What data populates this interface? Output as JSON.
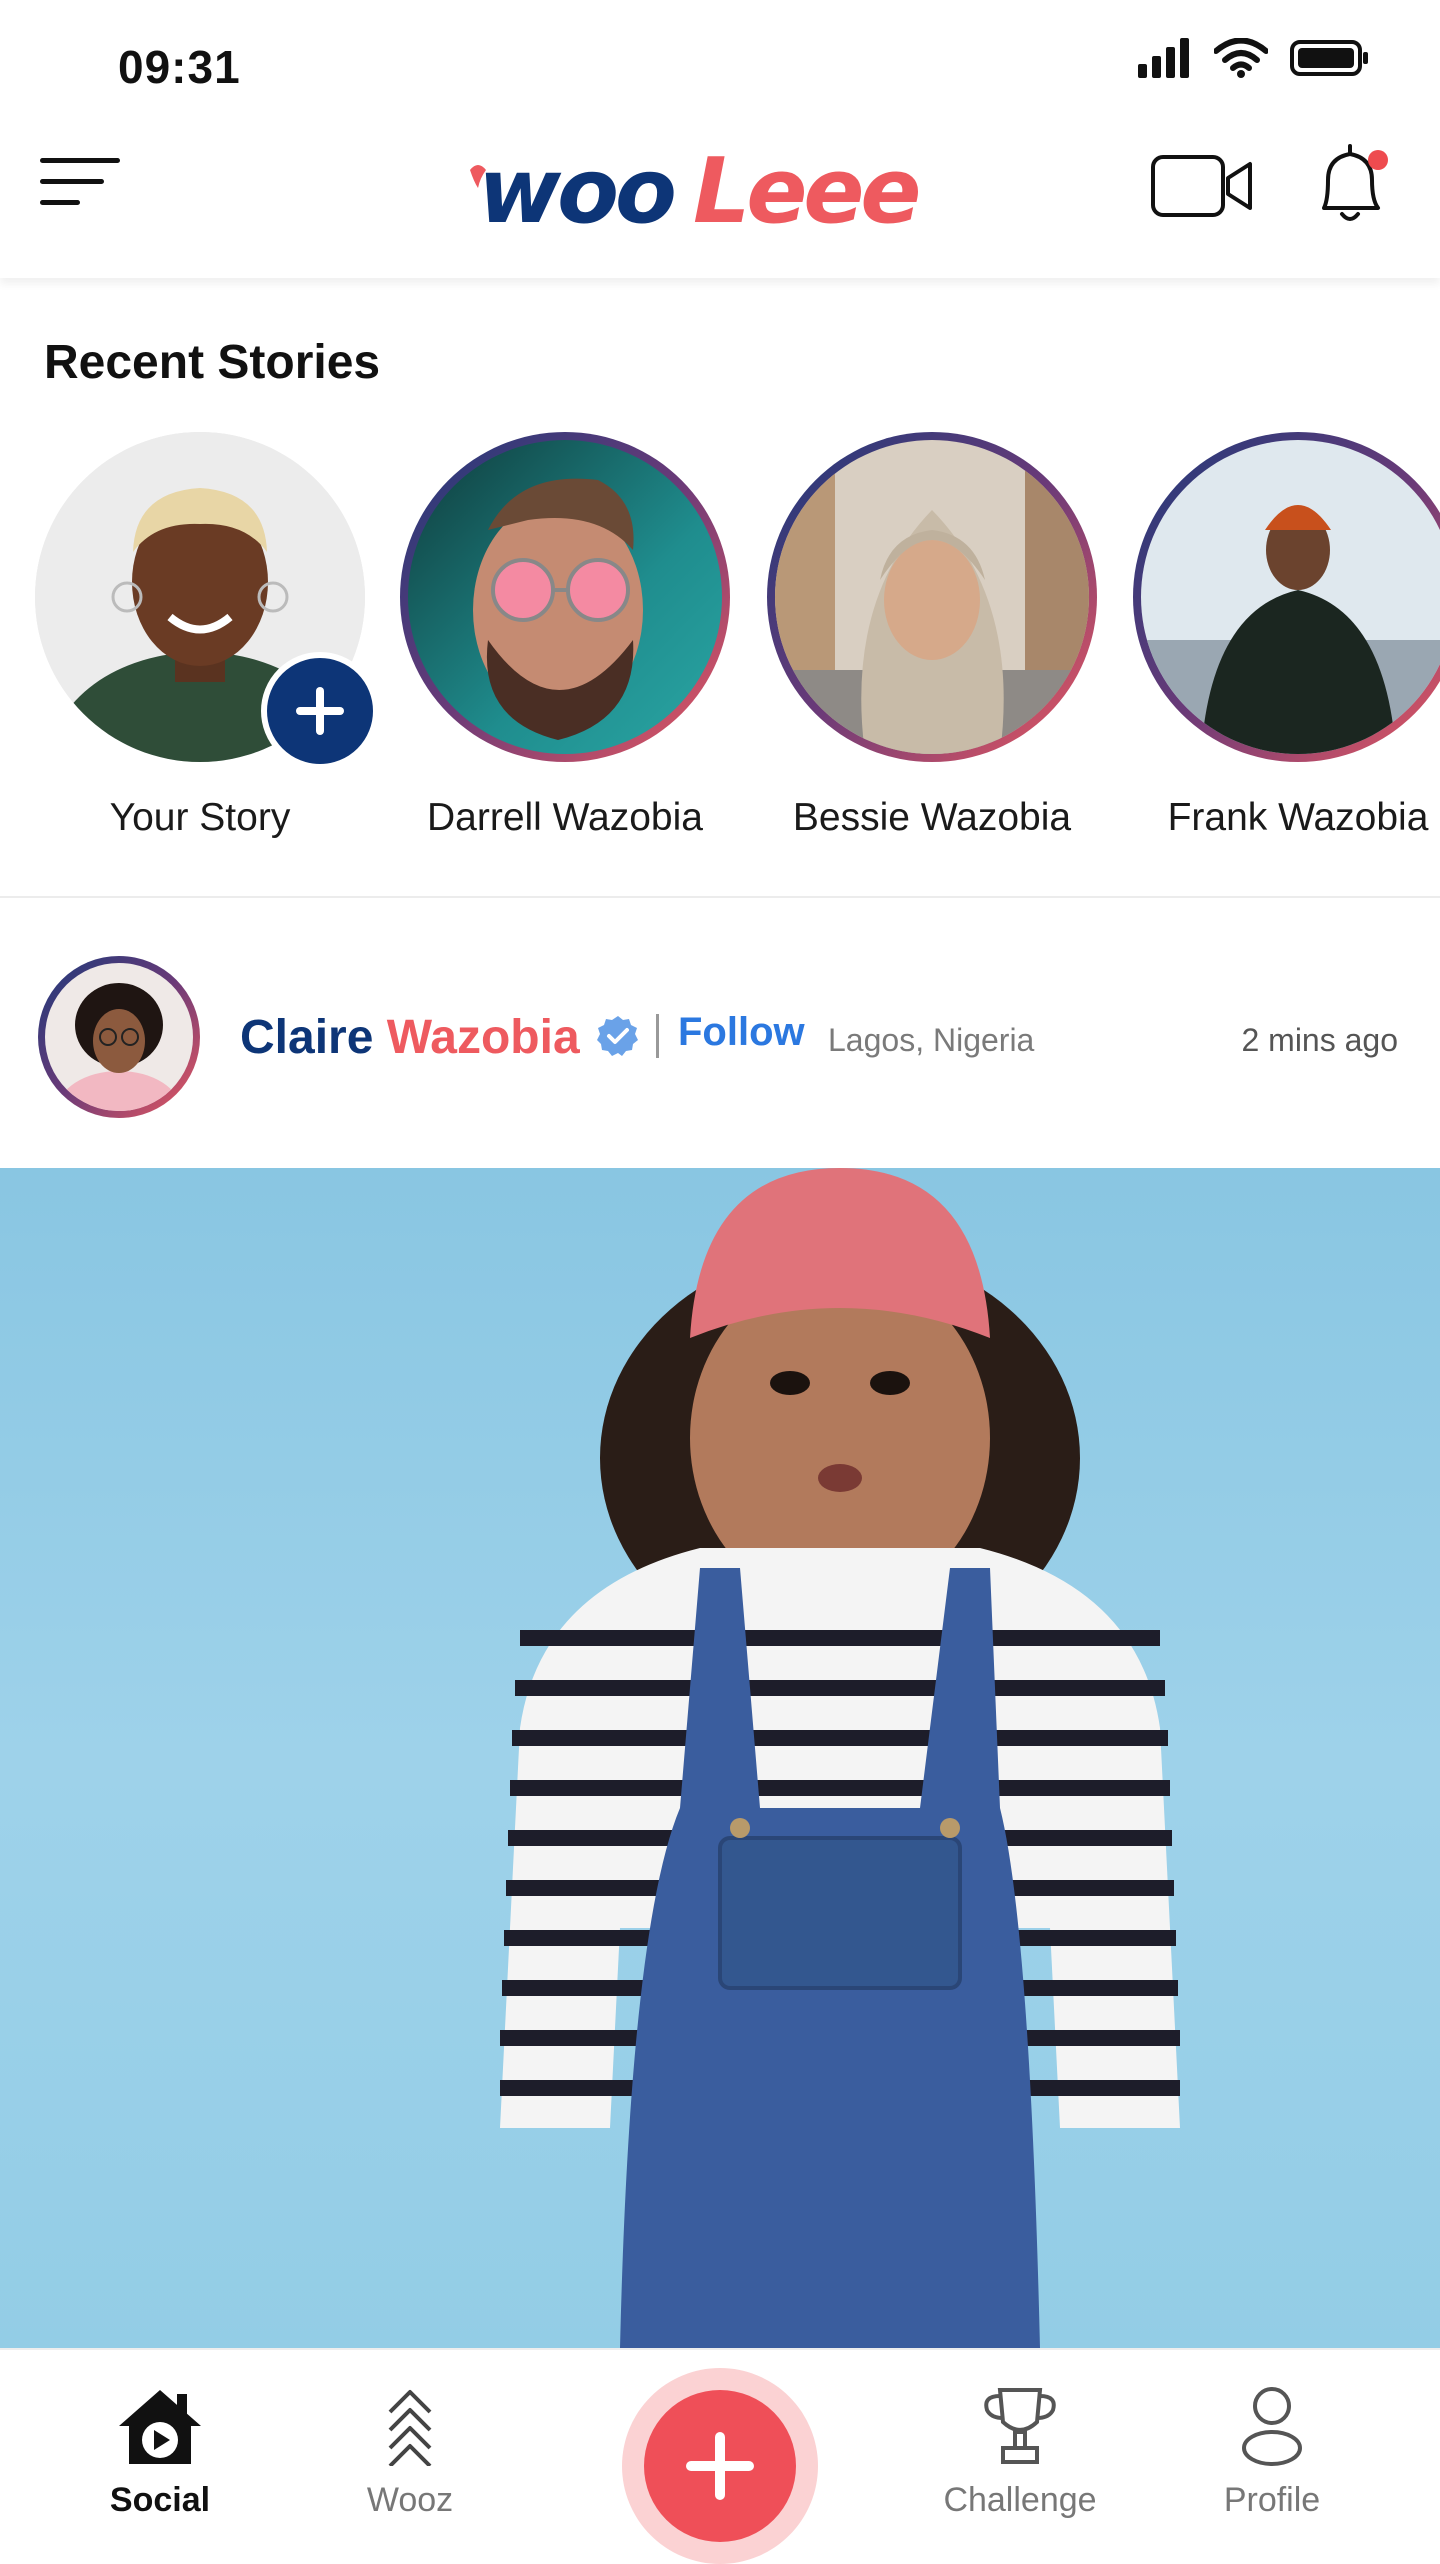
{
  "status_bar": {
    "time": "09:31"
  },
  "header": {
    "logo_text": "wooLeee"
  },
  "stories": {
    "title": "Recent Stories",
    "items": [
      {
        "name": "Your Story",
        "is_own": true
      },
      {
        "name": "Darrell Wazobia"
      },
      {
        "name": "Bessie Wazobia"
      },
      {
        "name": "Frank Wazobia"
      }
    ]
  },
  "post": {
    "author_first": "Claire",
    "author_last": "Wazobia",
    "follow_label": "Follow",
    "location": "Lagos, Nigeria",
    "time_ago": "2 mins ago"
  },
  "bottom_nav": {
    "items": [
      {
        "label": "Social",
        "icon": "home-play-icon",
        "active": true
      },
      {
        "label": "Wooz",
        "icon": "chevrons-up-icon",
        "active": false
      },
      {
        "label": "Challenge",
        "icon": "trophy-icon",
        "active": false
      },
      {
        "label": "Profile",
        "icon": "person-icon",
        "active": false
      }
    ],
    "create_icon": "plus-icon"
  },
  "colors": {
    "brand_navy": "#0d3577",
    "brand_coral": "#ee5a5f",
    "follow_blue": "#2b78e0",
    "fab_red": "#ef4f58"
  }
}
